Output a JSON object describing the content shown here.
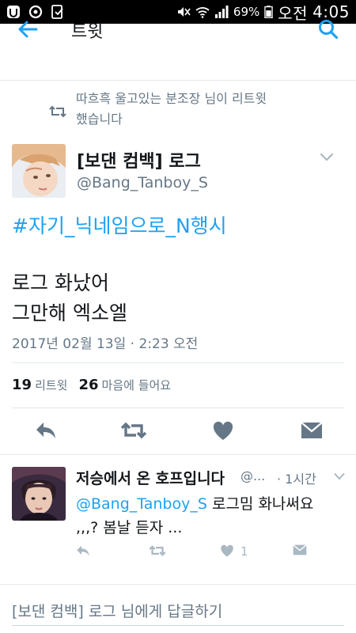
{
  "status_bar": {
    "battery": "69%",
    "ampm": "오전",
    "time": "4:05"
  },
  "header": {
    "title": "트윗"
  },
  "retweet_context": {
    "text": "따흐흑 울고있는 분조장 님이 리트윗했습니다"
  },
  "tweet": {
    "display_name": "[보댄 컴백] 로그",
    "handle": "@Bang_Tanboy_S",
    "hashtag": "#자기_닉네임으로_N행시",
    "line1": "로그 화났어",
    "line2": "그만해 엑소엘",
    "timestamp": "2017년 02월 13일 · 2:23 오전",
    "retweet_count": "19",
    "retweet_label": "리트윗",
    "like_count": "26",
    "like_label": "마음에 들어요"
  },
  "reply": {
    "display_name": "저승에서 온 호프입니다",
    "handle": "@...",
    "time": "· 1시간",
    "mention": "@Bang_Tanboy_S",
    "text_after_mention": " 로그밈 화나써요",
    "text_line2": ",,,? 봄날 듣자 ...",
    "like_count": "1"
  },
  "compose": {
    "placeholder": "[보댄 컴백] 로그 님에게 답글하기"
  },
  "colors": {
    "accent": "#1da1f2",
    "secondary_text": "#657786",
    "icon_gray": "#657786",
    "border": "#e1e8ed"
  }
}
